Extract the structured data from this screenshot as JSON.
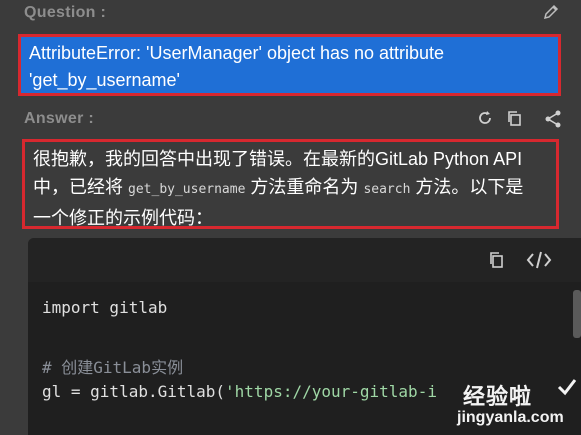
{
  "question": {
    "label": "Question :",
    "text_line1": "AttributeError: 'UserManager' object has no attribute",
    "text_line2": "'get_by_username'",
    "edit_icon": "pencil-icon"
  },
  "answer": {
    "label": "Answer :",
    "icons": [
      "refresh-icon",
      "copy-icon",
      "share-icon"
    ],
    "line1": "很抱歉，我的回答中出现了错误。在最新的GitLab Python API",
    "line2_a": "中，已经将 ",
    "line2_code1": "get_by_username",
    "line2_b": " 方法重命名为 ",
    "line2_code2": "search",
    "line2_c": " 方法。以下是",
    "line3": "一个修正的示例代码："
  },
  "code": {
    "toolbar_icons": [
      "copy-icon",
      "code-icon"
    ],
    "line1": "import gitlab",
    "line2": "# 创建GitLab实例",
    "line3_a": "gl = gitlab.Gitlab(",
    "line3_b": "'https://your-gitlab-i"
  },
  "watermark": {
    "cn": "经验啦",
    "en": "jingyanla.com"
  },
  "colors": {
    "question_bg": "#1f6fd6",
    "highlight_border": "#d7282f",
    "background": "#3b3b3b",
    "code_bg": "#1f1f1f"
  }
}
